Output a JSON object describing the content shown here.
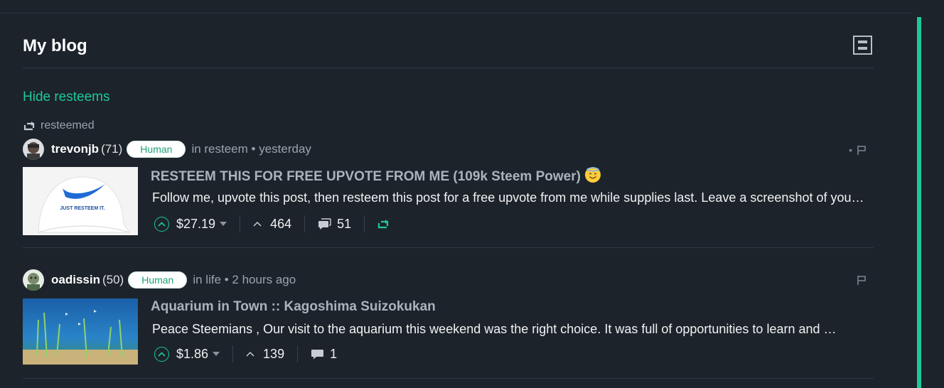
{
  "header": {
    "title": "My blog"
  },
  "hide_resteems": "Hide resteems",
  "resteemed_label": "resteemed",
  "posts": [
    {
      "author": "trevonjb",
      "reputation": "(71)",
      "badge": "Human",
      "category_time": "in resteem • yesterday",
      "title": "RESTEEM THIS FOR FREE UPVOTE FROM ME (109k Steem Power)",
      "summary": "Follow me, upvote this post, then resteem this post for a free upvote from me while supplies last. Leave a screenshot of your resteem in the comments.",
      "payout": "$27.19",
      "votes": "464",
      "comments": "51",
      "thumb_text": "JUST RESTEEM IT."
    },
    {
      "author": "oadissin",
      "reputation": "(50)",
      "badge": "Human",
      "category_time": "in life • 2 hours ago",
      "title": "Aquarium in Town :: Kagoshima Suizokukan",
      "summary": "Peace Steemians , Our visit to the aquarium this weekend was the right choice. It was full of opportunities to learn and watch the sea life up close.",
      "payout": "$1.86",
      "votes": "139",
      "comments": "1"
    }
  ],
  "colors": {
    "accent": "#1fc897",
    "background": "#1c232b"
  }
}
